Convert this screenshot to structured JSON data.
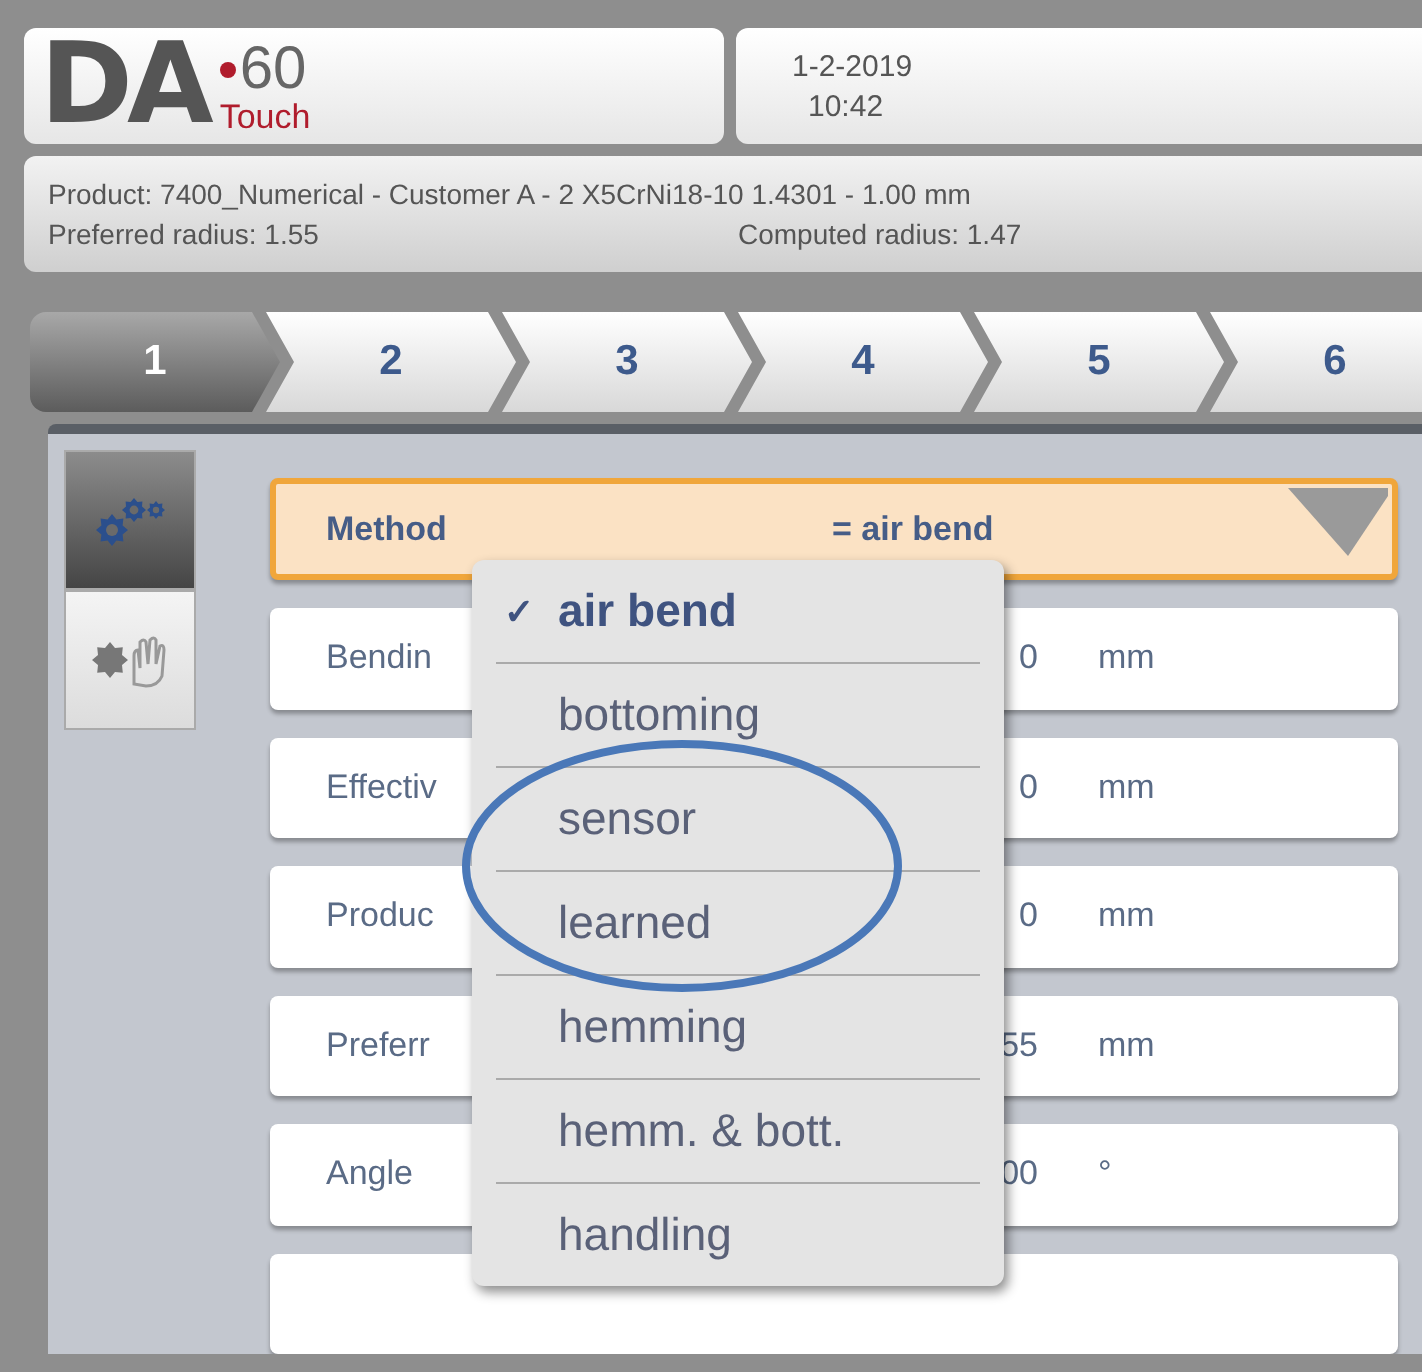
{
  "logo": {
    "letters": "DA",
    "model": "60",
    "edition": "Touch"
  },
  "datetime": {
    "date": "1-2-2019",
    "time": "10:42"
  },
  "info": {
    "product": "Product: 7400_Numerical - Customer A - 2 X5CrNi18-10 1.4301 - 1.00 mm",
    "preferred_radius": "Preferred radius: 1.55",
    "computed_radius": "Computed radius: 1.47"
  },
  "tabs": [
    {
      "label": "1",
      "selected": true
    },
    {
      "label": "2",
      "selected": false
    },
    {
      "label": "3",
      "selected": false
    },
    {
      "label": "4",
      "selected": false
    },
    {
      "label": "5",
      "selected": false
    },
    {
      "label": "6",
      "selected": false
    }
  ],
  "side_buttons": [
    {
      "kind": "gears",
      "selected": true
    },
    {
      "kind": "manual",
      "selected": false
    }
  ],
  "method": {
    "label": "Method",
    "value": "= air bend"
  },
  "rows": [
    {
      "label": "Bendin",
      "value": "0",
      "unit": "mm"
    },
    {
      "label": "Effectiv",
      "value": "0",
      "unit": "mm"
    },
    {
      "label": "Produc",
      "value": "0",
      "unit": "mm"
    },
    {
      "label": "Preferr",
      "value": "55",
      "unit": "mm"
    },
    {
      "label": "Angle",
      "value": "00",
      "unit": "°"
    }
  ],
  "dropdown": {
    "check_mark": "✓",
    "options": [
      {
        "label": "air bend",
        "selected": true
      },
      {
        "label": "bottoming",
        "selected": false
      },
      {
        "label": "sensor",
        "selected": false
      },
      {
        "label": "learned",
        "selected": false
      },
      {
        "label": "hemming",
        "selected": false
      },
      {
        "label": "hemm. & bott.",
        "selected": false
      },
      {
        "label": "handling",
        "selected": false
      }
    ]
  }
}
